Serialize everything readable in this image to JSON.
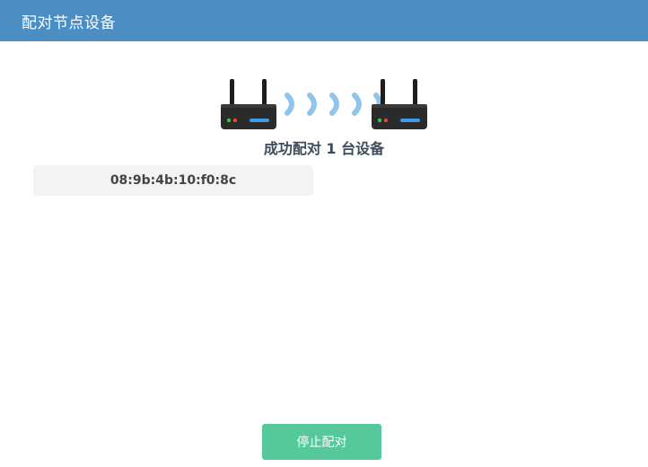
{
  "header": {
    "title": "配对节点设备"
  },
  "pairing": {
    "status_text": "成功配对 1 台设备",
    "devices": [
      "08:9b:4b:10:f0:8c"
    ]
  },
  "actions": {
    "stop_label": "停止配对"
  },
  "colors": {
    "header_bg": "#4a8ec4",
    "stop_button_bg": "#55c99b",
    "router_body": "#2b2b2b",
    "signal_wave": "#8fc4ec"
  }
}
